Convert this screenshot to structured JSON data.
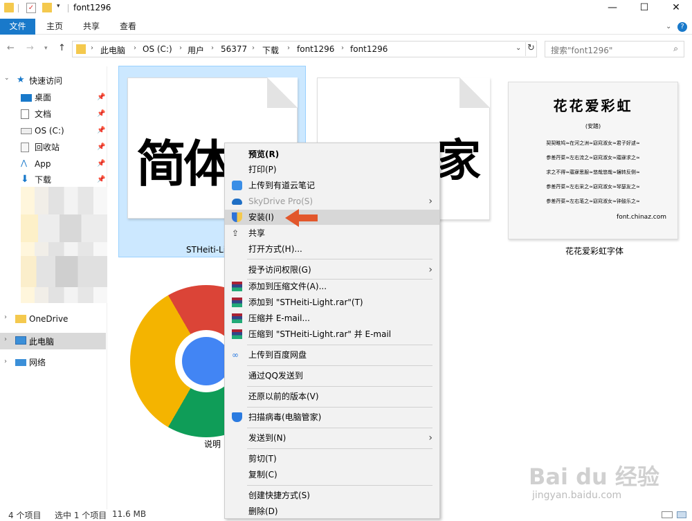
{
  "window": {
    "title": "font1296",
    "min": "—",
    "max": "☐",
    "close": "✕"
  },
  "ribbon": {
    "tabs": [
      "文件",
      "主页",
      "共享",
      "查看"
    ]
  },
  "address": {
    "crumbs": [
      "此电脑",
      "OS (C:)",
      "用户",
      "56377",
      "下载",
      "font1296",
      "font1296"
    ]
  },
  "search": {
    "placeholder": "搜索\"font1296\""
  },
  "sidebar": {
    "quick_access": "快速访问",
    "items": [
      "桌面",
      "文档",
      "OS (C:)",
      "回收站",
      "App",
      "下载"
    ],
    "onedrive": "OneDrive",
    "this_pc": "此电脑",
    "network": "网络"
  },
  "files": {
    "file1_label": "STHeiti-Li",
    "file1_preview": "简体",
    "file2_preview": "家",
    "file3_label": "花花爱彩虹字体",
    "file3_title": "花花爱彩虹",
    "file3_sub": "(安踏)",
    "file3_lines": [
      "契契睢鸠≈在河之洲≈窈窕淑女≈君子好逑≈",
      "参差荇菜≈左右流之≈窈窕淑女≈寤寐求之≈",
      "求之不得≈寤寐思服≈悠哉悠哉≈辗转反侧≈",
      "参差荇菜≈左右采之≈窈窕淑女≈琴瑟友之≈",
      "参差荇菜≈左右芼之≈窈窕淑女≈钟鼓乐之≈"
    ],
    "file3_url": "font.chinaz.com",
    "file4_label": "说明"
  },
  "status": {
    "count": "4 个项目",
    "selected": "选中 1 个项目",
    "size": "11.6 MB"
  },
  "menu": {
    "items": [
      {
        "label": "预览(R)",
        "bold": true
      },
      {
        "label": "打印(P)"
      },
      {
        "label": "上传到有道云笔记"
      },
      {
        "label": "SkyDrive Pro(S)",
        "disabled": true
      },
      {
        "label": "安装(I)",
        "highlight": true
      },
      {
        "label": "共享"
      },
      {
        "label": "打开方式(H)..."
      },
      {
        "label": "授予访问权限(G)"
      },
      {
        "label": "添加到压缩文件(A)..."
      },
      {
        "label": "添加到 \"STHeiti-Light.rar\"(T)"
      },
      {
        "label": "压缩并 E-mail..."
      },
      {
        "label": "压缩到 \"STHeiti-Light.rar\" 并 E-mail"
      },
      {
        "label": "上传到百度网盘"
      },
      {
        "label": "通过QQ发送到"
      },
      {
        "label": "还原以前的版本(V)"
      },
      {
        "label": "扫描病毒(电脑管家)"
      },
      {
        "label": "发送到(N)"
      },
      {
        "label": "剪切(T)"
      },
      {
        "label": "复制(C)"
      },
      {
        "label": "创建快捷方式(S)"
      },
      {
        "label": "删除(D)"
      }
    ]
  },
  "watermark": {
    "line1": "Bai du 经验",
    "line2": "jingyan.baidu.com"
  },
  "colors": {
    "accent": "#1979ca",
    "selection": "#cce8ff",
    "arrow": "#e2572c"
  }
}
